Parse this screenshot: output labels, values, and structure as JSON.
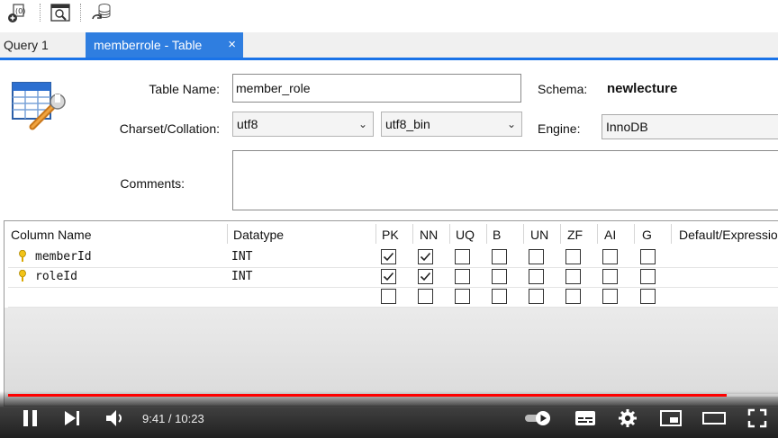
{
  "toolbar": {
    "icons": [
      "new-sql-icon",
      "inspect-icon",
      "database-sync-icon"
    ]
  },
  "tabs": [
    {
      "label": "Query 1",
      "active": false
    },
    {
      "label": "memberrole - Table",
      "active": true,
      "close": "×"
    }
  ],
  "form": {
    "table_name_label": "Table Name:",
    "table_name_value": "member_role",
    "schema_label": "Schema:",
    "schema_value": "newlecture",
    "charset_label": "Charset/Collation:",
    "charset_value": "utf8",
    "collation_value": "utf8_bin",
    "engine_label": "Engine:",
    "engine_value": "InnoDB",
    "comments_label": "Comments:",
    "comments_value": ""
  },
  "grid": {
    "headers": [
      "Column Name",
      "Datatype",
      "PK",
      "NN",
      "UQ",
      "B",
      "UN",
      "ZF",
      "AI",
      "G",
      "Default/Expression"
    ],
    "rows": [
      {
        "name": "memberId",
        "type": "INT",
        "checks": [
          true,
          true,
          false,
          false,
          false,
          false,
          false,
          false
        ]
      },
      {
        "name": "roleId",
        "type": "INT",
        "checks": [
          true,
          true,
          false,
          false,
          false,
          false,
          false,
          false
        ]
      },
      {
        "name": "",
        "type": "",
        "checks": [
          false,
          false,
          false,
          false,
          false,
          false,
          false,
          false
        ]
      }
    ]
  },
  "video": {
    "current_time": "9:41",
    "duration": "10:23",
    "time_display": "9:41 / 10:23",
    "progress": 0.933,
    "accent_color": "#ff0000"
  }
}
